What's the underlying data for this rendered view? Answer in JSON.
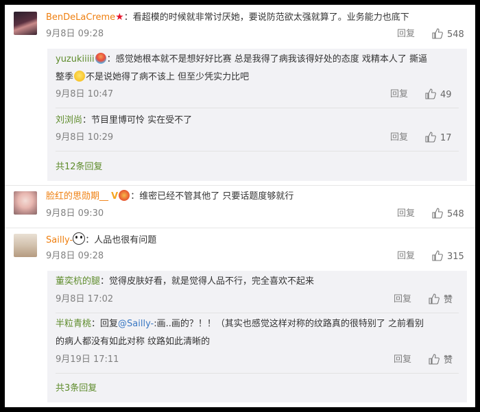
{
  "comments": [
    {
      "user": "BenDeLaCreme",
      "text": "：看超模的时候就非常讨厌她，要说防范欲太强就算了。业务能力也底下",
      "date": "9月8日 09:28",
      "reply": "回复",
      "likes": "548",
      "sub_replies": [
        {
          "user": "yuzukiiiii",
          "text_line1": "：感觉她根本就不是想好好比赛 总是我得了病我该得好处的态度 戏精本人了 撕逼",
          "text_line2_a": "整季",
          "text_line2_b": "不是说她得了病不该上 但至少凭实力比吧",
          "date": "9月8日 10:47",
          "reply": "回复",
          "likes": "49"
        },
        {
          "user": "刘浏尚",
          "text": "：节目里博可怜 实在受不了",
          "date": "9月8日 10:29",
          "reply": "回复",
          "likes": "17"
        }
      ],
      "more": "共12条回复"
    },
    {
      "user": "脸红的思勋期__",
      "text": "：维密已经不管其他了 只要话题度够就行",
      "date": "9月8日 09:30",
      "reply": "回复",
      "likes": "548"
    },
    {
      "user": "Sailly-",
      "text": "：人品也很有问题",
      "date": "9月8日 09:28",
      "reply": "回复",
      "likes": "315",
      "sub_replies": [
        {
          "user": "董奕杭的腿",
          "text": "：觉得皮肤好看，就是觉得人品不行，完全喜欢不起来",
          "date": "9月8日 17:02",
          "reply": "回复",
          "likes": "赞"
        },
        {
          "user": "半粒青桃",
          "text_prefix": "：回复",
          "mention": "@Sailly-",
          "text_line1": ":画..画的？！！（其实也感觉这样对称的纹路真的很特别了 之前看别",
          "text_line2": "的病人都没有如此对称 纹路如此清晰的",
          "date": "9月19日 17:11",
          "reply": "回复",
          "likes": "赞"
        }
      ],
      "more": "共3条回复"
    }
  ],
  "icons": {
    "thumb": "thumbs-up-icon",
    "star": "star-badge-icon",
    "bulb": "lightbulb-badge-icon",
    "v": "verified-v-icon",
    "panda": "panda-emoji-icon",
    "emoji": "thinking-emoji-icon"
  }
}
